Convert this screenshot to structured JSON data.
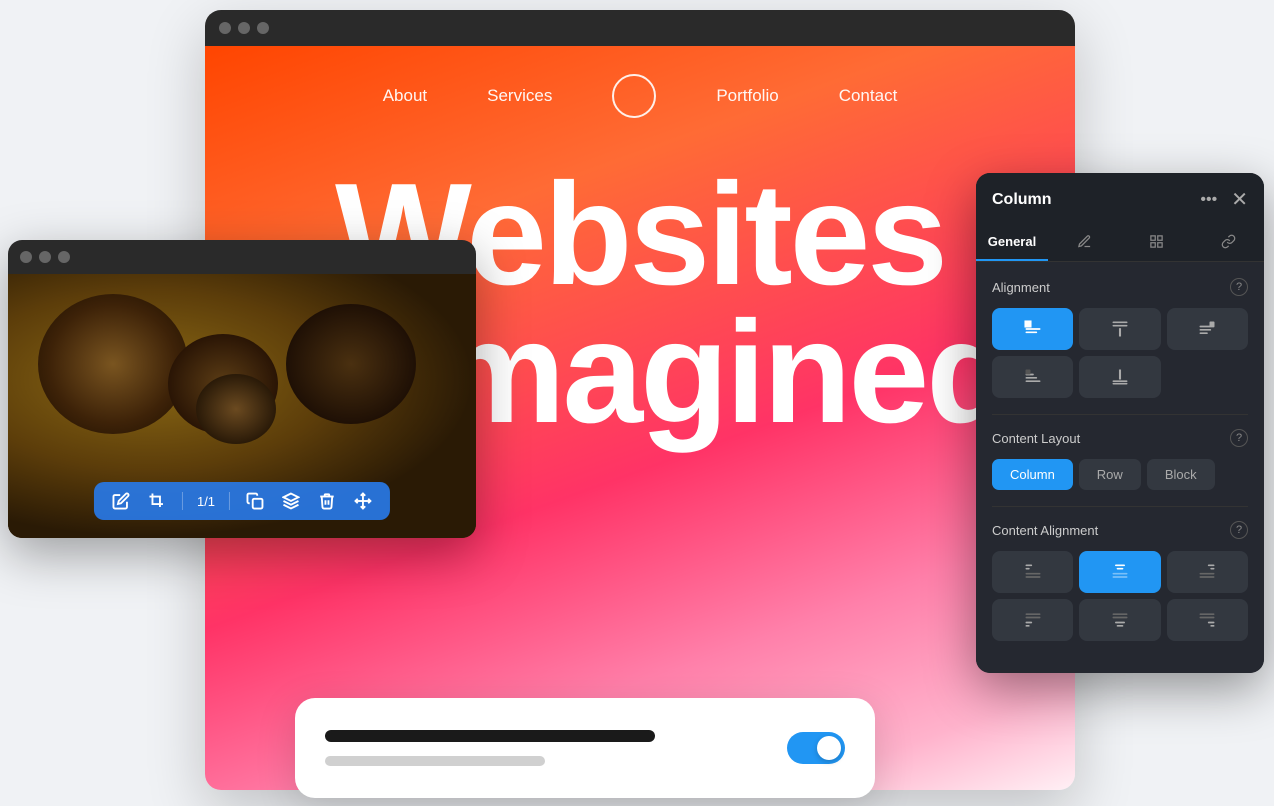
{
  "background": {
    "color": "#f0f2f5"
  },
  "main_preview": {
    "chrome_dots": [
      "#666",
      "#666",
      "#666"
    ],
    "nav": {
      "items": [
        "About",
        "Services",
        "Portfolio",
        "Contact"
      ]
    },
    "hero": {
      "line1": "Websites",
      "line2": "reimagined"
    }
  },
  "image_editor": {
    "toolbar": {
      "counter": "1/1",
      "icons": [
        "edit",
        "crop",
        "copy",
        "layer",
        "delete",
        "move"
      ]
    }
  },
  "column_panel": {
    "title": "Column",
    "header_actions": [
      "more",
      "close"
    ],
    "tabs": [
      {
        "label": "General",
        "active": true
      },
      {
        "label": "style",
        "active": false
      },
      {
        "label": "advanced",
        "active": false
      },
      {
        "label": "link",
        "active": false
      }
    ],
    "alignment": {
      "label": "Alignment",
      "buttons": [
        {
          "icon": "top-left",
          "active": true
        },
        {
          "icon": "top-center",
          "active": false
        },
        {
          "icon": "top-right",
          "active": false
        },
        {
          "icon": "bottom-left",
          "active": false
        },
        {
          "icon": "bottom-center",
          "active": false
        }
      ]
    },
    "content_layout": {
      "label": "Content Layout",
      "options": [
        {
          "label": "Column",
          "active": true
        },
        {
          "label": "Row",
          "active": false
        },
        {
          "label": "Block",
          "active": false
        }
      ]
    },
    "content_alignment": {
      "label": "Content Alignment",
      "buttons": [
        {
          "icon": "align-top-left",
          "active": false
        },
        {
          "icon": "align-top-center",
          "active": true
        },
        {
          "icon": "align-top-right",
          "active": false
        },
        {
          "icon": "align-bottom-left",
          "active": false
        },
        {
          "icon": "align-bottom-center",
          "active": false
        },
        {
          "icon": "align-bottom-right",
          "active": false
        }
      ]
    }
  },
  "toggle_card": {
    "line1_color": "#1a1a1a",
    "line2_color": "#d0d0d0",
    "toggle_on": true
  }
}
